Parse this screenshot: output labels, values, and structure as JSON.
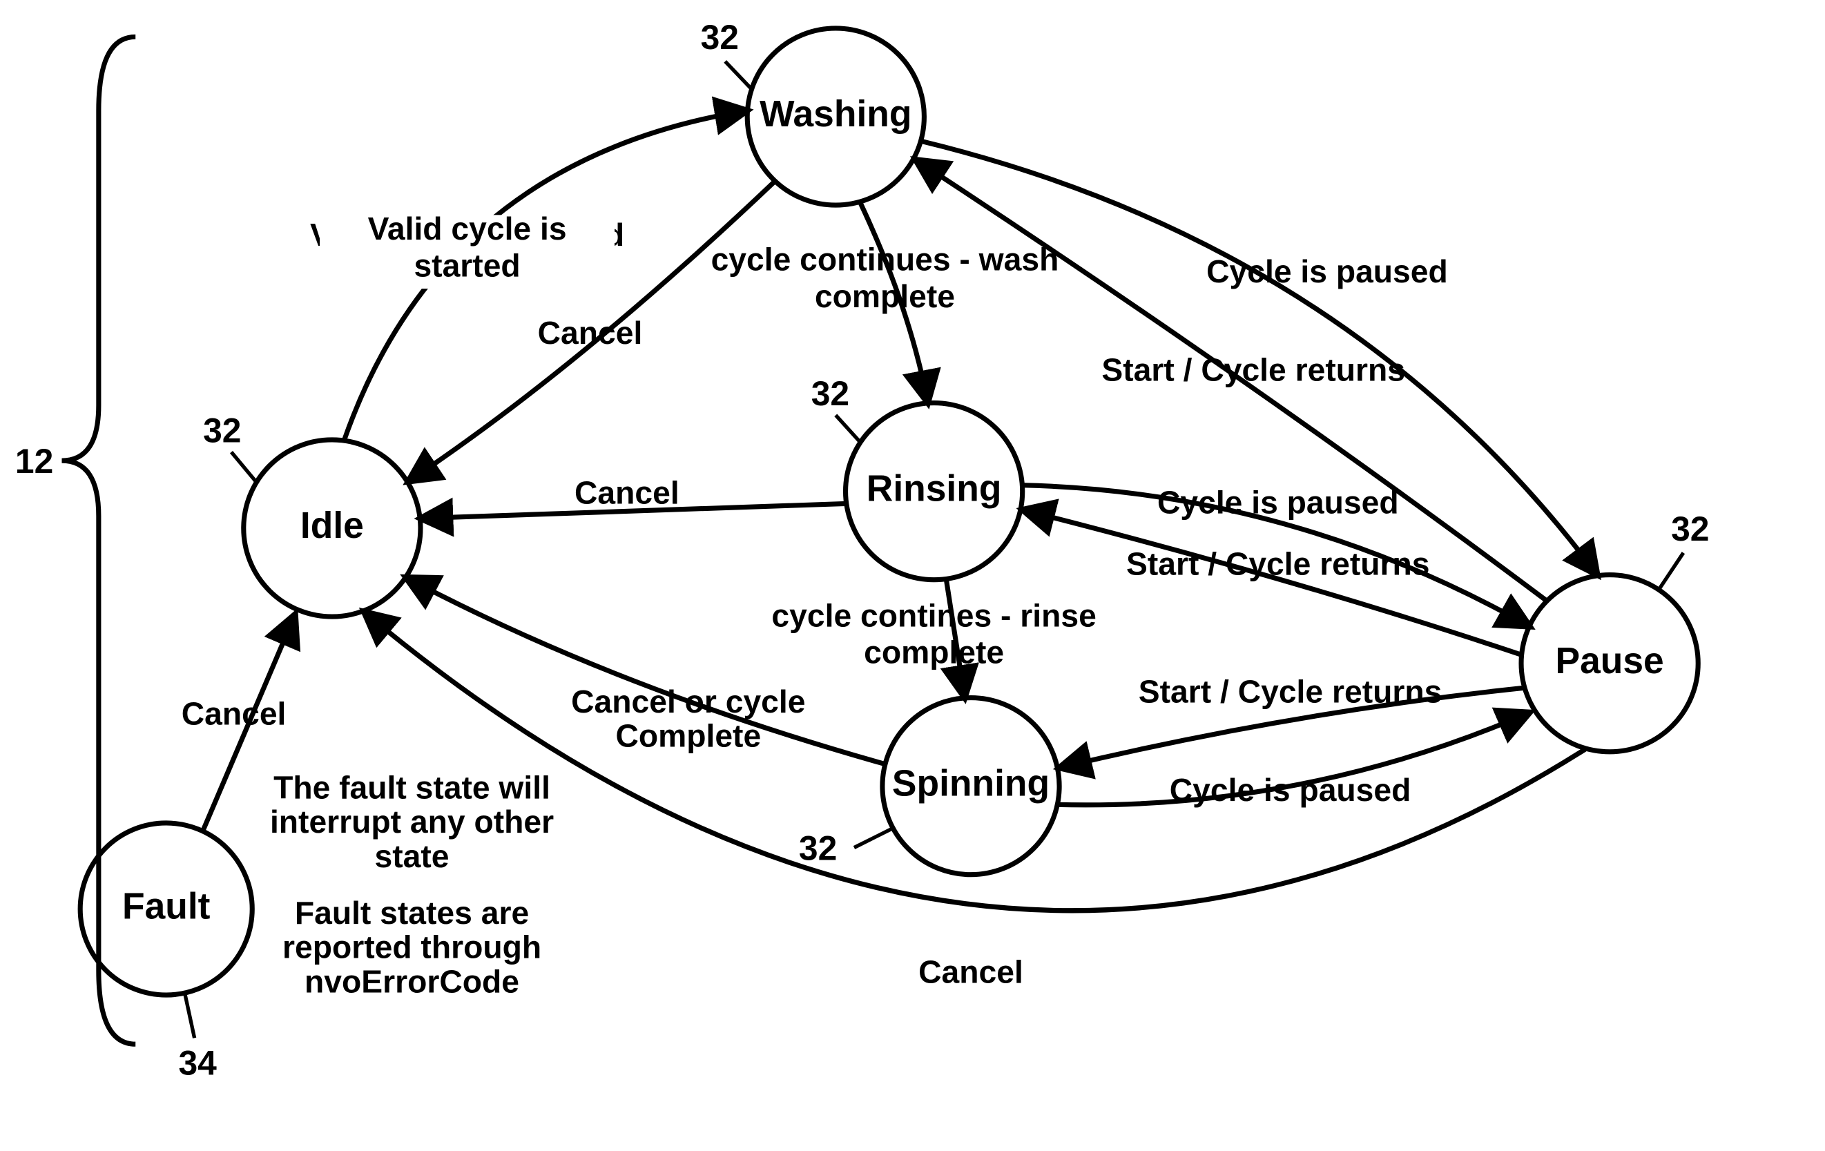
{
  "diagram": {
    "brace_ref": "12",
    "states": {
      "washing": {
        "label": "Washing",
        "ref": "32"
      },
      "rinsing": {
        "label": "Rinsing",
        "ref": "32"
      },
      "spinning": {
        "label": "Spinning",
        "ref": "32"
      },
      "idle": {
        "label": "Idle",
        "ref": "32"
      },
      "pause": {
        "label": "Pause",
        "ref": "32"
      },
      "fault": {
        "label": "Fault",
        "ref": "34"
      }
    },
    "edges": {
      "idle_to_washing": "Valid cycle is started",
      "washing_to_idle": "Cancel",
      "washing_to_rinsing_a": "cycle continues - wash",
      "washing_to_rinsing_b": "complete",
      "rinsing_to_idle": "Cancel",
      "rinsing_to_spinning_a": "cycle contines - rinse",
      "rinsing_to_spinning_b": "complete",
      "spinning_to_idle_a": "Cancel or cycle",
      "spinning_to_idle_b": "Complete",
      "washing_to_pause": "Cycle is paused",
      "pause_to_washing": "Start / Cycle returns",
      "rinsing_to_pause": "Cycle is paused",
      "pause_to_rinsing": "Start / Cycle returns",
      "spinning_to_pause": "Cycle is paused",
      "pause_to_spinning": "Start / Cycle returns",
      "pause_to_idle": "Cancel",
      "fault_to_idle": "Cancel"
    },
    "notes": {
      "fault_a": "The fault state will",
      "fault_b": "interrupt any other",
      "fault_c": "state",
      "fault_d": "Fault states are",
      "fault_e": "reported through",
      "fault_f": "nvoErrorCode"
    }
  }
}
